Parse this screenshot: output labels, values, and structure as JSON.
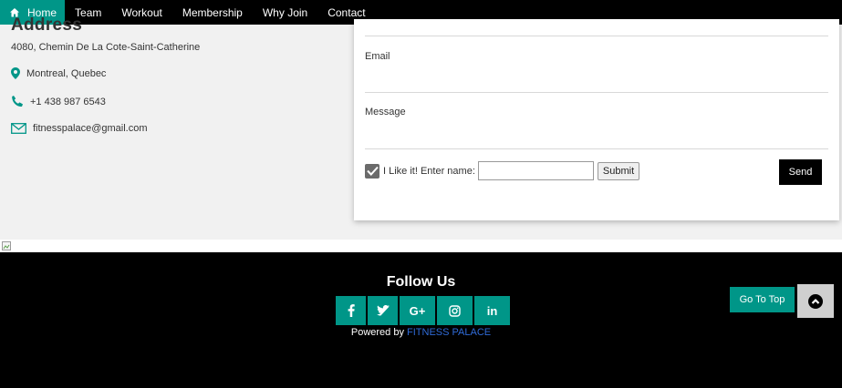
{
  "nav": {
    "home": "Home",
    "team": "Team",
    "workout": "Workout",
    "membership": "Membership",
    "why_join": "Why Join",
    "contact": "Contact"
  },
  "address": {
    "heading": "Address",
    "street": "4080, Chemin De La Cote-Saint-Catherine",
    "city": "Montreal, Quebec",
    "phone": "+1 438 987 6543",
    "email": "fitnesspalace@gmail.com"
  },
  "form": {
    "email_label": "Email",
    "message_label": "Message",
    "like_label": "I Like it! Enter name:",
    "name_value": "",
    "submit_label": "Submit",
    "send_label": "Send",
    "checkbox_checked": true
  },
  "footer": {
    "title": "Follow Us",
    "social": [
      "f",
      "♥",
      "G+",
      "◎",
      "in"
    ],
    "social_icons": [
      "facebook-icon",
      "twitter-icon",
      "google-plus-icon",
      "instagram-icon",
      "linkedin-icon"
    ],
    "powered_prefix": "Powered by",
    "powered_brand": "FITNESS PALACE",
    "go_top_label": "Go To Top"
  },
  "colors": {
    "accent": "#009688",
    "nav_bg": "#000000",
    "section_bg": "#f1f1f1",
    "brand_link": "#2f6bd8"
  }
}
